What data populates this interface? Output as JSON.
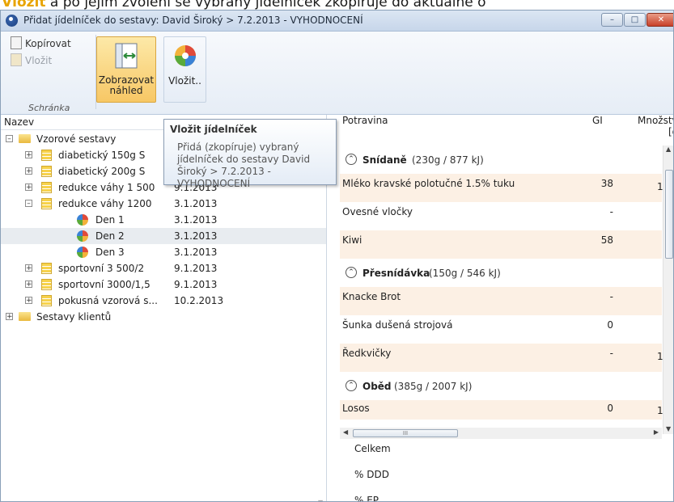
{
  "background_text": {
    "prefix": "Vložit",
    "rest": " a po jejím zvolení se vybraný jídelníček zkopíruje do aktuálně o"
  },
  "window": {
    "title": "Přidat jídelníček do sestavy: David Široký > 7.2.2013 - VYHODNOCENÍ"
  },
  "ribbon": {
    "copy_label": "Kopírovat",
    "paste_label": "Vložit",
    "preview_label": "Zobrazovat náhled",
    "insert_label": "Vložit..",
    "group_label": "Schránka"
  },
  "tree": {
    "column_header": "Nazev",
    "items": [
      {
        "label": "Vzorové sestavy",
        "date": ""
      },
      {
        "label": "diabetický 150g S",
        "date": ""
      },
      {
        "label": "diabetický 200g S",
        "date": ""
      },
      {
        "label": "redukce váhy 1 500",
        "date": "9.1.2013"
      },
      {
        "label": "redukce váhy 1200",
        "date": "3.1.2013"
      },
      {
        "label": "Den 1",
        "date": "3.1.2013"
      },
      {
        "label": "Den 2",
        "date": "3.1.2013"
      },
      {
        "label": "Den 3",
        "date": "3.1.2013"
      },
      {
        "label": "sportovní 3 500/2",
        "date": "9.1.2013"
      },
      {
        "label": "sportovní 3000/1,5",
        "date": "9.1.2013"
      },
      {
        "label": "pokusná vzorová s...",
        "date": "10.2.2013"
      },
      {
        "label": "Sestavy klientů",
        "date": ""
      }
    ]
  },
  "tooltip": {
    "title": "Vložit jídelníček",
    "body": "Přidá (zkopíruje) vybraný jídelníček do sestavy David Široký > 7.2.2013 - VYHODNOCENÍ"
  },
  "table": {
    "headers": {
      "food": "Potravina",
      "gi": "GI",
      "amount": "Množstv",
      "amount_unit": "[g"
    },
    "meals": [
      {
        "name": "Snídaně",
        "info": "(230g / 877 kJ)"
      },
      {
        "name": "Přesnídávka",
        "info": "(150g / 546 kJ)"
      },
      {
        "name": "Oběd",
        "info": "(385g / 2007 kJ)"
      }
    ],
    "foods": [
      {
        "name": "Mléko kravské polotučné 1.5% tuku",
        "gi": "38",
        "amount": "1"
      },
      {
        "name": "Ovesné vločky",
        "gi": "-",
        "amount": ""
      },
      {
        "name": "Kiwi",
        "gi": "58",
        "amount": ""
      },
      {
        "name": "Knacke Brot",
        "gi": "-",
        "amount": ""
      },
      {
        "name": "Šunka dušená strojová",
        "gi": "0",
        "amount": ""
      },
      {
        "name": "Ředkvičky",
        "gi": "-",
        "amount": "1"
      },
      {
        "name": "Losos",
        "gi": "0",
        "amount": "1"
      }
    ],
    "summary": {
      "total": "Celkem",
      "ddd": "% DDD",
      "ep": "% EP"
    }
  },
  "scroll_glyph": "III"
}
